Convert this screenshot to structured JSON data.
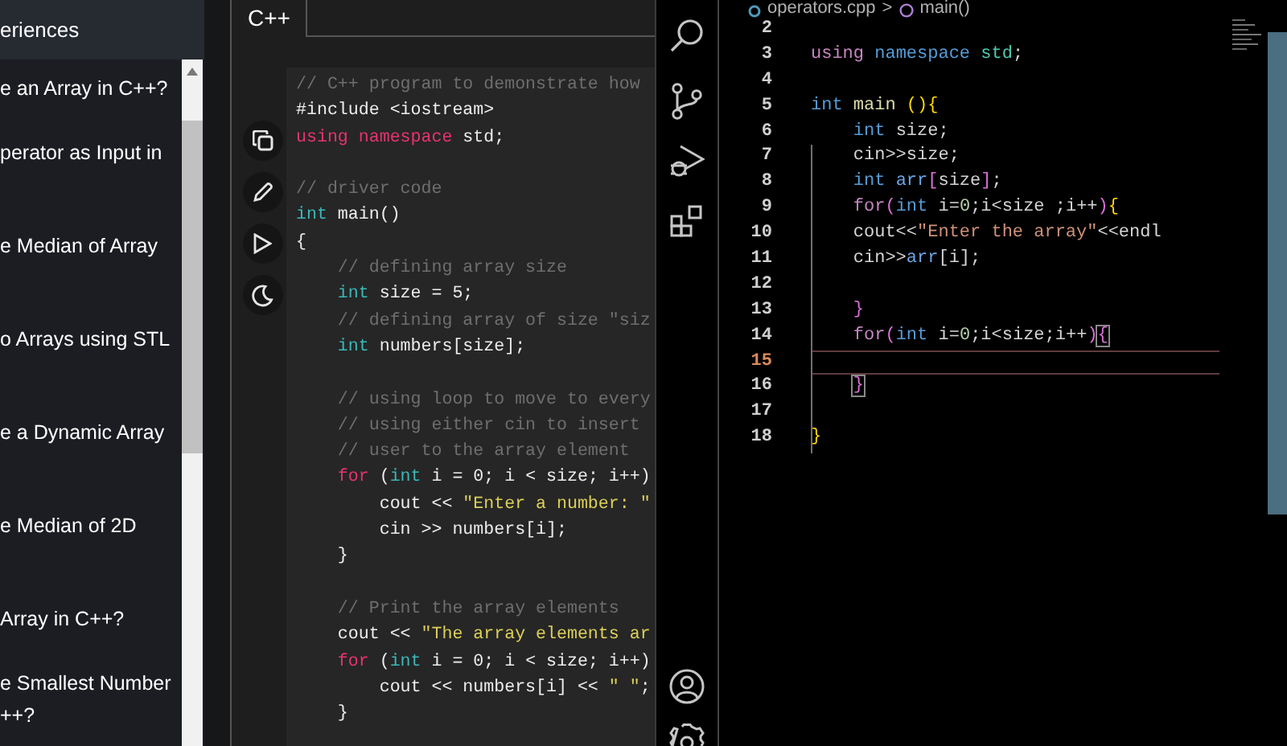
{
  "sidebar": {
    "header": "eriences",
    "items": [
      {
        "lines": [
          "e an Array in C++?"
        ]
      },
      {
        "lines": [
          "perator as Input in"
        ]
      },
      {
        "lines": [
          "e Median of Array"
        ]
      },
      {
        "lines": [
          "o Arrays using STL"
        ]
      },
      {
        "lines": [
          "e a Dynamic Array"
        ]
      },
      {
        "lines": [
          "e Median of 2D"
        ]
      },
      {
        "lines": [
          "Array in C++?"
        ]
      },
      {
        "lines": [
          "e Smallest Number",
          "++?"
        ]
      }
    ]
  },
  "code_panel": {
    "tabs": [
      {
        "label": "C++",
        "selected": true
      }
    ],
    "lines": [
      {
        "kind": "code",
        "tokens": [
          {
            "kind": "comment",
            "text": "// C++ program to demonstrate how"
          }
        ]
      },
      {
        "kind": "code",
        "tokens": [
          {
            "kind": "plain",
            "text": "#include <iostream>"
          }
        ]
      },
      {
        "kind": "code",
        "tokens": [
          {
            "kind": "keyword",
            "text": "using namespace"
          },
          {
            "kind": "plain",
            "text": " std;"
          }
        ]
      },
      {
        "kind": "blank"
      },
      {
        "kind": "code",
        "tokens": [
          {
            "kind": "comment",
            "text": "// driver code"
          }
        ]
      },
      {
        "kind": "code",
        "tokens": [
          {
            "kind": "type",
            "text": "int"
          },
          {
            "kind": "plain",
            "text": " main()"
          }
        ]
      },
      {
        "kind": "code",
        "tokens": [
          {
            "kind": "plain",
            "text": "{"
          }
        ]
      },
      {
        "kind": "code",
        "tokens": [
          {
            "kind": "comment",
            "text": "    // defining array size"
          }
        ]
      },
      {
        "kind": "code",
        "tokens": [
          {
            "kind": "type",
            "text": "    int"
          },
          {
            "kind": "plain",
            "text": " size = 5;"
          }
        ]
      },
      {
        "kind": "code",
        "tokens": [
          {
            "kind": "comment",
            "text": "    // defining array of size \"siz"
          }
        ]
      },
      {
        "kind": "code",
        "tokens": [
          {
            "kind": "type",
            "text": "    int"
          },
          {
            "kind": "plain",
            "text": " numbers[size];"
          }
        ]
      },
      {
        "kind": "blank"
      },
      {
        "kind": "code",
        "tokens": [
          {
            "kind": "comment",
            "text": "    // using loop to move to every"
          }
        ]
      },
      {
        "kind": "code",
        "tokens": [
          {
            "kind": "comment",
            "text": "    // using either cin to insert"
          }
        ]
      },
      {
        "kind": "code",
        "tokens": [
          {
            "kind": "comment",
            "text": "    // user to the array element"
          }
        ]
      },
      {
        "kind": "code",
        "tokens": [
          {
            "kind": "keyword",
            "text": "    for"
          },
          {
            "kind": "plain",
            "text": " ("
          },
          {
            "kind": "type",
            "text": "int"
          },
          {
            "kind": "plain",
            "text": " i = 0; i < size; i++)"
          }
        ]
      },
      {
        "kind": "code",
        "tokens": [
          {
            "kind": "plain",
            "text": "        cout << "
          },
          {
            "kind": "string",
            "text": "\"Enter a number: \""
          }
        ]
      },
      {
        "kind": "code",
        "tokens": [
          {
            "kind": "plain",
            "text": "        cin >> numbers[i];"
          }
        ]
      },
      {
        "kind": "code",
        "tokens": [
          {
            "kind": "plain",
            "text": "    }"
          }
        ]
      },
      {
        "kind": "blank"
      },
      {
        "kind": "code",
        "tokens": [
          {
            "kind": "comment",
            "text": "    // Print the array elements"
          }
        ]
      },
      {
        "kind": "code",
        "tokens": [
          {
            "kind": "plain",
            "text": "    cout << "
          },
          {
            "kind": "string",
            "text": "\"The array elements ar"
          }
        ]
      },
      {
        "kind": "code",
        "tokens": [
          {
            "kind": "keyword",
            "text": "    for"
          },
          {
            "kind": "plain",
            "text": " ("
          },
          {
            "kind": "type",
            "text": "int"
          },
          {
            "kind": "plain",
            "text": " i = 0; i < size; i++)"
          }
        ]
      },
      {
        "kind": "code",
        "tokens": [
          {
            "kind": "plain",
            "text": "        cout << numbers[i] << "
          },
          {
            "kind": "string",
            "text": "\" \""
          },
          {
            "kind": "plain",
            "text": ";"
          }
        ]
      },
      {
        "kind": "code",
        "tokens": [
          {
            "kind": "plain",
            "text": "    }"
          }
        ]
      }
    ]
  },
  "editor": {
    "breadcrumb": {
      "file": "operators.cpp",
      "separator": ">",
      "symbol": "main()"
    },
    "lines": [
      {
        "number": "2",
        "current": false
      },
      {
        "number": "3",
        "current": false,
        "tokens": [
          {
            "kind": "keyword",
            "text": "using"
          },
          {
            "kind": "type",
            "text": " namespace"
          },
          {
            "kind": "namespace",
            "text": " std"
          },
          {
            "kind": "plain",
            "text": ";"
          }
        ]
      },
      {
        "number": "4",
        "current": false
      },
      {
        "number": "5",
        "current": false,
        "tokens": [
          {
            "kind": "type",
            "text": "int"
          },
          {
            "kind": "function",
            "text": " main"
          },
          {
            "kind": "bracket",
            "text": " (){"
          }
        ]
      },
      {
        "number": "6",
        "current": false,
        "tokens": [
          {
            "kind": "type",
            "text": "    int"
          },
          {
            "kind": "plain",
            "text": " size;"
          }
        ]
      },
      {
        "number": "7",
        "current": false,
        "tokens": [
          {
            "kind": "plain",
            "text": "    cin>>size;"
          }
        ]
      },
      {
        "number": "8",
        "current": false,
        "tokens": [
          {
            "kind": "type",
            "text": "    int"
          },
          {
            "kind": "variable",
            "text": " arr"
          },
          {
            "kind": "bracket2",
            "text": "["
          },
          {
            "kind": "plain",
            "text": "size"
          },
          {
            "kind": "bracket2",
            "text": "]"
          },
          {
            "kind": "plain",
            "text": ";"
          }
        ]
      },
      {
        "number": "9",
        "current": false,
        "tokens": [
          {
            "kind": "keyword",
            "text": "    for"
          },
          {
            "kind": "bracket2",
            "text": "("
          },
          {
            "kind": "type",
            "text": "int"
          },
          {
            "kind": "plain",
            "text": " i="
          },
          {
            "kind": "number",
            "text": "0"
          },
          {
            "kind": "plain",
            "text": ";i<size ;i++"
          },
          {
            "kind": "bracket2",
            "text": ")"
          },
          {
            "kind": "bracket3",
            "text": "{"
          }
        ]
      },
      {
        "number": "10",
        "current": false,
        "tokens": [
          {
            "kind": "plain",
            "text": "    cout<<"
          },
          {
            "kind": "string",
            "text": "\"Enter the array\""
          },
          {
            "kind": "plain",
            "text": "<<endl"
          }
        ]
      },
      {
        "number": "11",
        "current": false,
        "tokens": [
          {
            "kind": "plain",
            "text": "    cin>>"
          },
          {
            "kind": "variable",
            "text": "arr"
          },
          {
            "kind": "plain",
            "text": "[i];"
          }
        ]
      },
      {
        "number": "12",
        "current": false
      },
      {
        "number": "13",
        "current": false,
        "tokens": [
          {
            "kind": "bracket2",
            "text": "    }"
          }
        ]
      },
      {
        "number": "14",
        "current": false,
        "tokens": [
          {
            "kind": "keyword",
            "text": "    for"
          },
          {
            "kind": "bracket2",
            "text": "("
          },
          {
            "kind": "type",
            "text": "int"
          },
          {
            "kind": "plain",
            "text": " i="
          },
          {
            "kind": "number",
            "text": "0"
          },
          {
            "kind": "plain",
            "text": ";i<size;i++"
          },
          {
            "kind": "bracket2",
            "text": ")"
          },
          {
            "kind": "match",
            "text": "{"
          }
        ]
      },
      {
        "number": "15",
        "current": true
      },
      {
        "number": "16",
        "current": false,
        "indented": true,
        "tokens": [
          {
            "kind": "match",
            "text": "}"
          }
        ]
      },
      {
        "number": "17",
        "current": false
      },
      {
        "number": "18",
        "current": false,
        "tokens": [
          {
            "kind": "bracket",
            "text": "}"
          }
        ]
      }
    ]
  }
}
